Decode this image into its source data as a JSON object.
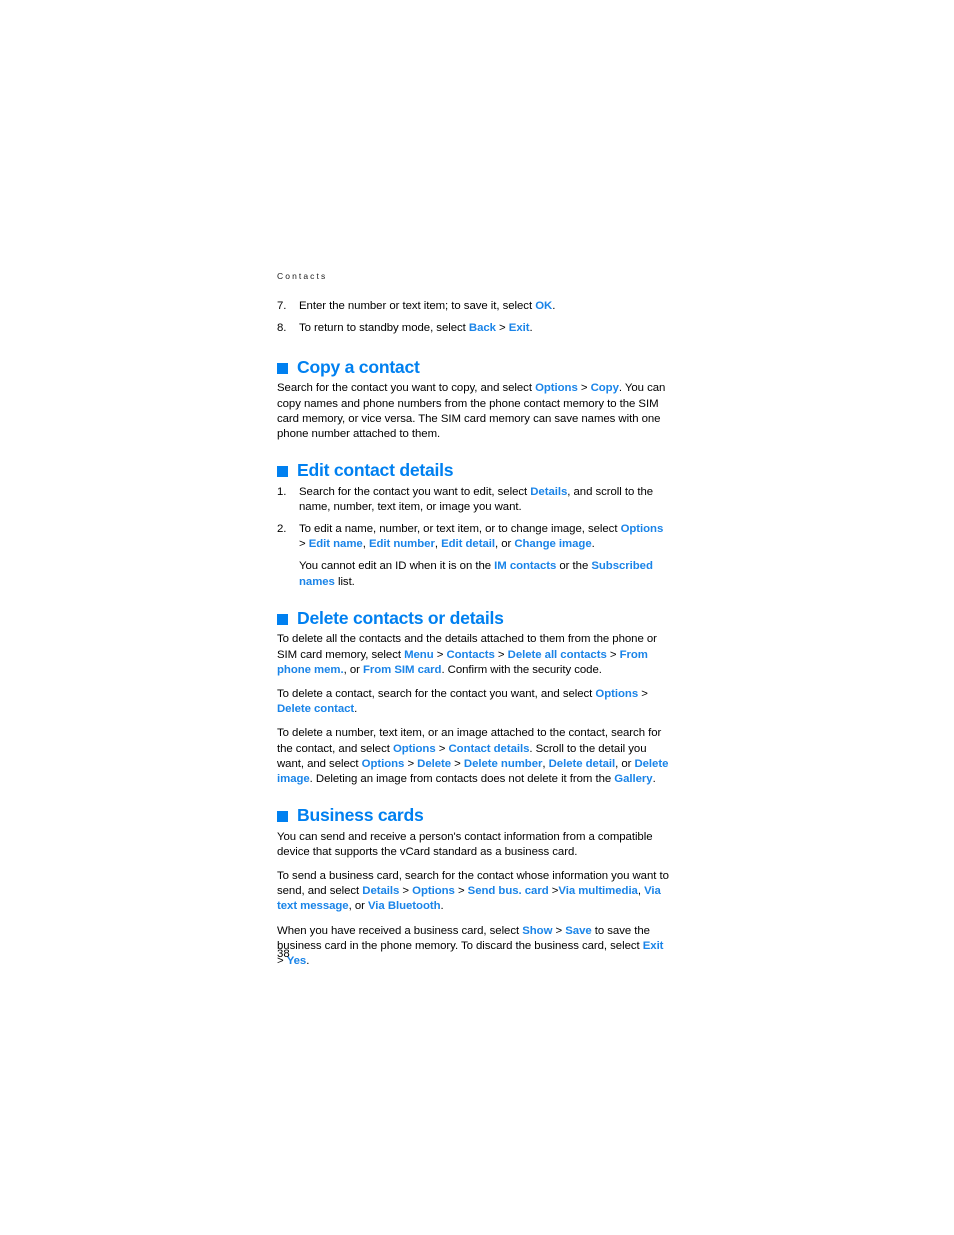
{
  "document": {
    "running_head": "Contacts",
    "page_number": "38",
    "accent_color": "#0080f0",
    "link_color": "#1a84e8",
    "text_color": "#000000"
  },
  "continued_list": [
    {
      "number": "7.",
      "parts": [
        {
          "t": "Enter the number or text item; to save it, select ",
          "k": false
        },
        {
          "t": "OK",
          "k": true
        },
        {
          "t": ".",
          "k": false
        }
      ]
    },
    {
      "number": "8.",
      "parts": [
        {
          "t": "To return to standby mode, select ",
          "k": false
        },
        {
          "t": "Back",
          "k": true
        },
        {
          "t": " > ",
          "k": false
        },
        {
          "t": "Exit",
          "k": true
        },
        {
          "t": ".",
          "k": false
        }
      ]
    }
  ],
  "sections": [
    {
      "id": "copy-a-contact",
      "title": "Copy a contact",
      "blocks": [
        {
          "type": "paragraph",
          "parts": [
            {
              "t": "Search for the contact you want to copy, and select ",
              "k": false
            },
            {
              "t": "Options",
              "k": true
            },
            {
              "t": " > ",
              "k": false
            },
            {
              "t": "Copy",
              "k": true
            },
            {
              "t": ". You can copy names and phone numbers from the phone contact memory to the SIM card memory, or vice versa. The SIM card memory can save names with one phone number attached to them.",
              "k": false
            }
          ]
        }
      ]
    },
    {
      "id": "edit-contact-details",
      "title": "Edit contact details",
      "blocks": [
        {
          "type": "numbered",
          "number": "1.",
          "parts": [
            {
              "t": "Search for the contact you want to edit, select ",
              "k": false
            },
            {
              "t": "Details",
              "k": true
            },
            {
              "t": ", and scroll to the name, number, text item, or image you want.",
              "k": false
            }
          ]
        },
        {
          "type": "numbered",
          "number": "2.",
          "parts": [
            {
              "t": "To edit a name, number, or text item, or to change image, select ",
              "k": false
            },
            {
              "t": "Options",
              "k": true
            },
            {
              "t": " > ",
              "k": false
            },
            {
              "t": "Edit name",
              "k": true
            },
            {
              "t": ", ",
              "k": false
            },
            {
              "t": "Edit number",
              "k": true
            },
            {
              "t": ", ",
              "k": false
            },
            {
              "t": "Edit detail",
              "k": true
            },
            {
              "t": ", or ",
              "k": false
            },
            {
              "t": "Change image",
              "k": true
            },
            {
              "t": ".",
              "k": false
            }
          ]
        },
        {
          "type": "subnote",
          "parts": [
            {
              "t": "You cannot edit an ID when it is on the ",
              "k": false
            },
            {
              "t": "IM contacts",
              "k": true
            },
            {
              "t": " or the ",
              "k": false
            },
            {
              "t": "Subscribed names",
              "k": true
            },
            {
              "t": " list.",
              "k": false
            }
          ]
        }
      ]
    },
    {
      "id": "delete-contacts-or-details",
      "title": "Delete contacts or details",
      "blocks": [
        {
          "type": "paragraph",
          "parts": [
            {
              "t": "To delete all the contacts and the details attached to them from the phone or SIM card memory, select ",
              "k": false
            },
            {
              "t": "Menu",
              "k": true
            },
            {
              "t": " > ",
              "k": false
            },
            {
              "t": "Contacts",
              "k": true
            },
            {
              "t": " > ",
              "k": false
            },
            {
              "t": "Delete all contacts",
              "k": true
            },
            {
              "t": " > ",
              "k": false
            },
            {
              "t": "From phone mem.",
              "k": true
            },
            {
              "t": ", or ",
              "k": false
            },
            {
              "t": "From SIM card",
              "k": true
            },
            {
              "t": ". Confirm with the security code.",
              "k": false
            }
          ]
        },
        {
          "type": "paragraph",
          "parts": [
            {
              "t": "To delete a contact, search for the contact you want, and select ",
              "k": false
            },
            {
              "t": "Options",
              "k": true
            },
            {
              "t": " > ",
              "k": false
            },
            {
              "t": "Delete contact",
              "k": true
            },
            {
              "t": ".",
              "k": false
            }
          ]
        },
        {
          "type": "paragraph",
          "parts": [
            {
              "t": "To delete a number, text item, or an image attached to the contact, search for the contact, and select ",
              "k": false
            },
            {
              "t": "Options",
              "k": true
            },
            {
              "t": " > ",
              "k": false
            },
            {
              "t": "Contact details",
              "k": true
            },
            {
              "t": ". Scroll to the detail you want, and select ",
              "k": false
            },
            {
              "t": "Options",
              "k": true
            },
            {
              "t": " > ",
              "k": false
            },
            {
              "t": "Delete",
              "k": true
            },
            {
              "t": " > ",
              "k": false
            },
            {
              "t": "Delete number",
              "k": true
            },
            {
              "t": ", ",
              "k": false
            },
            {
              "t": "Delete detail",
              "k": true
            },
            {
              "t": ", or ",
              "k": false
            },
            {
              "t": "Delete image",
              "k": true
            },
            {
              "t": ". Deleting an image from contacts does not delete it from the ",
              "k": false
            },
            {
              "t": "Gallery",
              "k": true
            },
            {
              "t": ".",
              "k": false
            }
          ]
        }
      ]
    },
    {
      "id": "business-cards",
      "title": "Business cards",
      "blocks": [
        {
          "type": "paragraph",
          "parts": [
            {
              "t": "You can send and receive a person's contact information from a compatible device that supports the vCard standard as a business card.",
              "k": false
            }
          ]
        },
        {
          "type": "paragraph",
          "parts": [
            {
              "t": "To send a business card, search for the contact whose information you want to send, and select ",
              "k": false
            },
            {
              "t": "Details",
              "k": true
            },
            {
              "t": " > ",
              "k": false
            },
            {
              "t": "Options",
              "k": true
            },
            {
              "t": " > ",
              "k": false
            },
            {
              "t": "Send bus. card",
              "k": true
            },
            {
              "t": " >",
              "k": false
            },
            {
              "t": "Via multimedia",
              "k": true
            },
            {
              "t": ", ",
              "k": false
            },
            {
              "t": "Via text message",
              "k": true
            },
            {
              "t": ", or ",
              "k": false
            },
            {
              "t": "Via Bluetooth",
              "k": true
            },
            {
              "t": ".",
              "k": false
            }
          ]
        },
        {
          "type": "paragraph",
          "parts": [
            {
              "t": "When you have received a business card, select ",
              "k": false
            },
            {
              "t": "Show",
              "k": true
            },
            {
              "t": " > ",
              "k": false
            },
            {
              "t": "Save",
              "k": true
            },
            {
              "t": " to save the business card in the phone memory. To discard the business card, select ",
              "k": false
            },
            {
              "t": "Exit",
              "k": true
            },
            {
              "t": " > ",
              "k": false
            },
            {
              "t": "Yes",
              "k": true
            },
            {
              "t": ".",
              "k": false
            }
          ]
        }
      ]
    }
  ]
}
